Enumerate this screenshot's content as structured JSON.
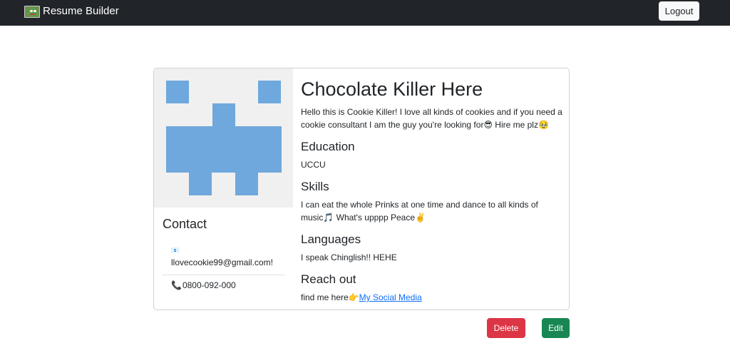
{
  "navbar": {
    "brand_text": "Resume Builder",
    "brand_icon": "pepe-frog-logo",
    "logout_label": "Logout"
  },
  "profile": {
    "name": "Chocolate Killer Here",
    "intro_text": "Hello this is Cookie Killer! I love all kinds of cookies and if you need a cookie consultant I am the guy you're looking for",
    "intro_emoji1": "😎",
    "intro_suffix": " Hire me plz",
    "intro_emoji2": "🥹",
    "avatar_color": "#6fa8dc",
    "avatar_bg": "#f0f0f0"
  },
  "contact": {
    "title": "Contact",
    "email_icon": "📧",
    "email": "llovecookie99@gmail.com!",
    "phone_icon": "📞",
    "phone": "0800-092-000"
  },
  "sections": {
    "education_title": "Education",
    "education_text": "UCCU",
    "skills_title": "Skills",
    "skills_text": "I can eat the whole Prinks at one time and dance to all kinds of music",
    "skills_emoji1": "🎵",
    "skills_suffix": " What's upppp Peace",
    "skills_emoji2": "✌️",
    "languages_title": "Languages",
    "languages_text": "I speak Chinglish!! HEHE",
    "reach_title": "Reach out",
    "reach_text": "find me here",
    "reach_emoji": "👉",
    "reach_link": "My Social Media"
  },
  "actions": {
    "delete_label": "Delete",
    "edit_label": "Edit"
  },
  "colors": {
    "navbar": "#212529",
    "danger": "#dc3545",
    "success": "#198754",
    "link": "#0d6efd"
  }
}
